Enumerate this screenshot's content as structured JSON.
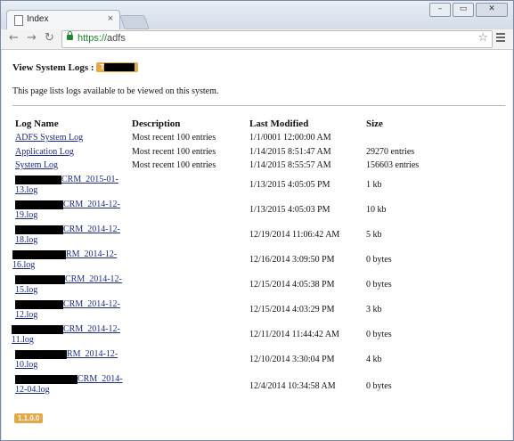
{
  "browser": {
    "tab_title": "Index",
    "tab_close": "×",
    "url_scheme": "https://",
    "url_host": "adfs",
    "window_buttons": [
      "–",
      "▭",
      "✕"
    ]
  },
  "page": {
    "heading": "View System Logs :",
    "heading_badge": "T",
    "description": "This page lists logs available to be viewed on this system.",
    "columns": [
      "Log Name",
      "Description",
      "Last Modified",
      "Size"
    ],
    "rows": [
      {
        "name": "ADFS System Log",
        "description": "Most recent 100 entries",
        "modified": "1/1/0001 12:00:00 AM",
        "size": ""
      },
      {
        "name": "Application Log",
        "description": "Most recent 100 entries",
        "modified": "1/14/2015 8:51:47 AM",
        "size": "29270 entries"
      },
      {
        "name": "System Log",
        "description": "Most recent 100 entries",
        "modified": "1/14/2015 8:55:57 AM",
        "size": "156603 entries"
      }
    ],
    "files": [
      {
        "name_a": "CRM_2015-01-",
        "name_b": "13.log",
        "modified": "1/13/2015 4:05:05 PM",
        "size": "1 kb"
      },
      {
        "name_a": "CRM_2014-12-",
        "name_b": "19.log",
        "modified": "1/13/2015 4:05:03 PM",
        "size": "10 kb"
      },
      {
        "name_a": "CRM_2014-12-",
        "name_b": "18.log",
        "modified": "12/19/2014 11:06:42 AM",
        "size": "5 kb"
      },
      {
        "name_a": "RM_2014-12-",
        "name_b": "16.log",
        "modified": "12/16/2014 3:09:50 PM",
        "size": "0 bytes"
      },
      {
        "name_a": "CRM_2014-12-",
        "name_b": "15.log",
        "modified": "12/15/2014 4:05:38 PM",
        "size": "0 bytes"
      },
      {
        "name_a": "CRM_2014-12-",
        "name_b": "12.log",
        "modified": "12/15/2014 4:03:29 PM",
        "size": "3 kb"
      },
      {
        "name_a": "CRM_2014-12-",
        "name_b": "11.log",
        "modified": "12/11/2014 11:44:42 AM",
        "size": "0 bytes"
      },
      {
        "name_a": "RM_2014-12-",
        "name_b": "10.log",
        "modified": "12/10/2014 3:30:04 PM",
        "size": "4 kb"
      },
      {
        "name_a": "CRM_2014-",
        "name_b": "12-04.log",
        "modified": "12/4/2014 10:34:58 AM",
        "size": "0 bytes"
      }
    ],
    "version": "1.1.0.0"
  }
}
